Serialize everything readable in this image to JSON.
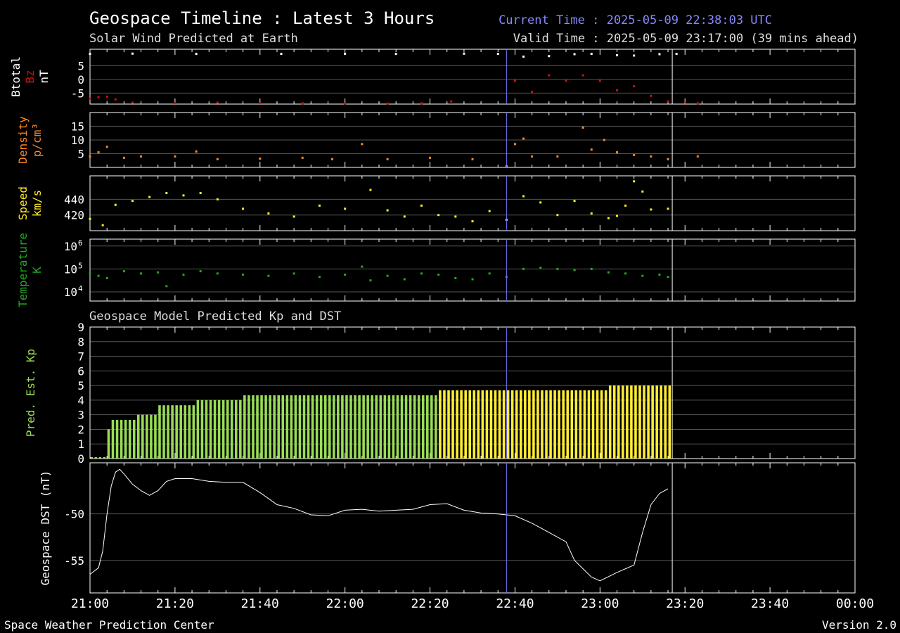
{
  "header": {
    "title": "Geospace Timeline : Latest 3 Hours",
    "subtitle": "Solar Wind Predicted at Earth",
    "current_time": "Current Time : 2025-05-09 22:38:03 UTC",
    "valid_time": "Valid Time : 2025-05-09 23:17:00 (39 mins ahead)"
  },
  "model_title": "Geospace Model Predicted Kp and DST",
  "footer": {
    "left": "Space Weather Prediction Center",
    "right": "Version 2.0"
  },
  "colors": {
    "background": "#000000",
    "btotal": "#ffffff",
    "bz": "#cc1111",
    "density": "#ff8822",
    "speed": "#ffee22",
    "temperature": "#22aa22",
    "kp_green": "#99dd55",
    "kp_yellow": "#ffee33",
    "current_line": "#7777ff",
    "valid_line": "#ffffff",
    "current_time_text": "#8888ff",
    "valid_time_text": "#dddddd",
    "grid": "#555555"
  },
  "chart_data": [
    {
      "panel": "magnetic_field",
      "type": "scatter",
      "ylabels": [
        {
          "text": "Btotal",
          "color": "#ffffff"
        },
        {
          "text": "Bz",
          "color": "#cc1111"
        },
        {
          "text": "nT",
          "color": "#ffffff"
        }
      ],
      "ylim": [
        -9,
        11
      ],
      "yticks": [
        {
          "v": 5,
          "label": "5"
        },
        {
          "v": 0,
          "label": "0"
        },
        {
          "v": -5,
          "label": "-5"
        }
      ],
      "series": [
        {
          "name": "Btotal",
          "color": "#ffffff",
          "points": [
            [
              0,
              9.3
            ],
            [
              10,
              9.4
            ],
            [
              25,
              9.3
            ],
            [
              45,
              9.3
            ],
            [
              60,
              9.3
            ],
            [
              72,
              9.3
            ],
            [
              88,
              9.4
            ],
            [
              96,
              9.3
            ],
            [
              102,
              8.3
            ],
            [
              108,
              8.5
            ],
            [
              114,
              9.2
            ],
            [
              118,
              9.3
            ],
            [
              124,
              8.8
            ],
            [
              128,
              8.7
            ],
            [
              134,
              9.2
            ],
            [
              138,
              9.3
            ]
          ]
        },
        {
          "name": "Bz",
          "color": "#cc1111",
          "points": [
            [
              0,
              -7
            ],
            [
              2,
              -6.5
            ],
            [
              4,
              -6.3
            ],
            [
              6,
              -7.3
            ],
            [
              10,
              -8.5
            ],
            [
              20,
              -8.6
            ],
            [
              30,
              -8.5
            ],
            [
              40,
              -8.6
            ],
            [
              50,
              -8.7
            ],
            [
              60,
              -8.8
            ],
            [
              70,
              -8.8
            ],
            [
              78,
              -8.7
            ],
            [
              85,
              -8
            ],
            [
              100,
              -0.5
            ],
            [
              104,
              -4.5
            ],
            [
              108,
              1.5
            ],
            [
              112,
              -0.5
            ],
            [
              116,
              1.5
            ],
            [
              120,
              -0.5
            ],
            [
              124,
              -4
            ],
            [
              128,
              -2.5
            ],
            [
              132,
              -6
            ],
            [
              136,
              -8
            ],
            [
              140,
              -8.5
            ],
            [
              143,
              -8.7
            ]
          ]
        }
      ]
    },
    {
      "panel": "density",
      "type": "scatter",
      "ylabels": [
        {
          "text": "Density",
          "color": "#ff8822"
        },
        {
          "text": "p/cm³",
          "color": "#ff8822"
        }
      ],
      "ylim": [
        0,
        20
      ],
      "yticks": [
        {
          "v": 15,
          "label": "15"
        },
        {
          "v": 10,
          "label": "10"
        },
        {
          "v": 5,
          "label": "5"
        }
      ],
      "series": [
        {
          "name": "Density",
          "color": "#ff8822",
          "points": [
            [
              0,
              4
            ],
            [
              2,
              5.5
            ],
            [
              4,
              7.5
            ],
            [
              8,
              3.5
            ],
            [
              12,
              4
            ],
            [
              20,
              4
            ],
            [
              25,
              5.8
            ],
            [
              30,
              3
            ],
            [
              40,
              3.2
            ],
            [
              50,
              3.5
            ],
            [
              57,
              3
            ],
            [
              64,
              8.5
            ],
            [
              70,
              3
            ],
            [
              80,
              3.5
            ],
            [
              90,
              3
            ],
            [
              98,
              0.5
            ],
            [
              100,
              8.5
            ],
            [
              102,
              10.5
            ],
            [
              104,
              4
            ],
            [
              110,
              4
            ],
            [
              116,
              14.5
            ],
            [
              118,
              6.5
            ],
            [
              121,
              10
            ],
            [
              124,
              5.5
            ],
            [
              128,
              4.5
            ],
            [
              132,
              4
            ],
            [
              136,
              3
            ],
            [
              143,
              4
            ]
          ]
        }
      ]
    },
    {
      "panel": "speed",
      "type": "scatter",
      "ylabels": [
        {
          "text": "Speed",
          "color": "#ffee22"
        },
        {
          "text": "km/s",
          "color": "#ffee22"
        }
      ],
      "ylim": [
        400,
        470
      ],
      "yticks": [
        {
          "v": 440,
          "label": "440"
        },
        {
          "v": 420,
          "label": "420"
        }
      ],
      "series": [
        {
          "name": "Speed",
          "color": "#ffee22",
          "points": [
            [
              0,
              415
            ],
            [
              3,
              407
            ],
            [
              6,
              433
            ],
            [
              10,
              438
            ],
            [
              14,
              443
            ],
            [
              18,
              448
            ],
            [
              22,
              445
            ],
            [
              26,
              448
            ],
            [
              30,
              440
            ],
            [
              36,
              428
            ],
            [
              42,
              422
            ],
            [
              48,
              418
            ],
            [
              54,
              432
            ],
            [
              60,
              428
            ],
            [
              66,
              452
            ],
            [
              70,
              426
            ],
            [
              74,
              418
            ],
            [
              78,
              432
            ],
            [
              82,
              420
            ],
            [
              86,
              418
            ],
            [
              90,
              412
            ],
            [
              94,
              425
            ],
            [
              98,
              414
            ],
            [
              102,
              444
            ],
            [
              106,
              436
            ],
            [
              110,
              420
            ],
            [
              114,
              438
            ],
            [
              118,
              422
            ],
            [
              122,
              416
            ],
            [
              124,
              419
            ],
            [
              126,
              432
            ],
            [
              128,
              463
            ],
            [
              130,
              450
            ],
            [
              132,
              427
            ],
            [
              136,
              428
            ]
          ]
        }
      ]
    },
    {
      "panel": "temperature",
      "type": "scatter",
      "log": true,
      "ylabels": [
        {
          "text": "Temperature",
          "color": "#22aa22"
        },
        {
          "text": "K",
          "color": "#22aa22"
        }
      ],
      "ylim": [
        3.6,
        6.3
      ],
      "yticks": [
        {
          "v": 6,
          "label": "10",
          "sup": "6"
        },
        {
          "v": 5,
          "label": "10",
          "sup": "5"
        },
        {
          "v": 4,
          "label": "10",
          "sup": "4"
        }
      ],
      "series": [
        {
          "name": "Temperature",
          "color": "#22aa22",
          "points": [
            [
              0,
              4.8
            ],
            [
              2,
              4.7
            ],
            [
              4,
              4.6
            ],
            [
              8,
              4.9
            ],
            [
              12,
              4.8
            ],
            [
              16,
              4.85
            ],
            [
              18,
              4.25
            ],
            [
              22,
              4.75
            ],
            [
              26,
              4.9
            ],
            [
              30,
              4.8
            ],
            [
              36,
              4.75
            ],
            [
              42,
              4.7
            ],
            [
              48,
              4.8
            ],
            [
              54,
              4.65
            ],
            [
              60,
              4.75
            ],
            [
              64,
              5.1
            ],
            [
              66,
              4.5
            ],
            [
              70,
              4.7
            ],
            [
              74,
              4.55
            ],
            [
              78,
              4.8
            ],
            [
              82,
              4.75
            ],
            [
              86,
              4.6
            ],
            [
              90,
              4.55
            ],
            [
              94,
              4.8
            ],
            [
              98,
              4.65
            ],
            [
              102,
              5.0
            ],
            [
              106,
              5.05
            ],
            [
              110,
              5.0
            ],
            [
              114,
              4.95
            ],
            [
              118,
              5.0
            ],
            [
              122,
              4.85
            ],
            [
              126,
              4.8
            ],
            [
              130,
              4.7
            ],
            [
              134,
              4.75
            ],
            [
              136,
              4.65
            ]
          ]
        }
      ]
    },
    {
      "panel": "kp",
      "type": "bar",
      "ylabels": [
        {
          "text": "Pred. Est. Kp",
          "color": "#99dd55"
        }
      ],
      "ylim": [
        0,
        9
      ],
      "yticks": [
        {
          "v": 9,
          "label": "9"
        },
        {
          "v": 8,
          "label": "8"
        },
        {
          "v": 7,
          "label": "7"
        },
        {
          "v": 6,
          "label": "6"
        },
        {
          "v": 5,
          "label": "5"
        },
        {
          "v": 4,
          "label": "4"
        },
        {
          "v": 3,
          "label": "3"
        },
        {
          "v": 2,
          "label": "2"
        },
        {
          "v": 1,
          "label": "1"
        },
        {
          "v": 0,
          "label": "0"
        }
      ],
      "segments": [
        {
          "start": 0,
          "end": 4,
          "value": 0.1,
          "color": "#99dd55"
        },
        {
          "start": 4,
          "end": 5,
          "value": 2.0,
          "color": "#99dd55"
        },
        {
          "start": 5,
          "end": 11,
          "value": 2.65,
          "color": "#99dd55"
        },
        {
          "start": 11,
          "end": 16,
          "value": 3.0,
          "color": "#99dd55"
        },
        {
          "start": 16,
          "end": 25,
          "value": 3.65,
          "color": "#99dd55"
        },
        {
          "start": 25,
          "end": 36,
          "value": 4.0,
          "color": "#99dd55"
        },
        {
          "start": 36,
          "end": 82,
          "value": 4.33,
          "color": "#99dd55"
        },
        {
          "start": 82,
          "end": 122,
          "value": 4.67,
          "color": "#ffee33"
        },
        {
          "start": 122,
          "end": 137,
          "value": 5.0,
          "color": "#ffee33"
        }
      ]
    },
    {
      "panel": "dst",
      "type": "line",
      "ylabels": [
        {
          "text": "Geospace DST (nT)",
          "color": "#ffffff"
        }
      ],
      "ylim": [
        -58.5,
        -44.5
      ],
      "yticks": [
        {
          "v": -50,
          "label": "-50"
        },
        {
          "v": -55,
          "label": "-55"
        }
      ],
      "series": [
        {
          "name": "DST",
          "color": "#ffffff",
          "points": [
            [
              0,
              -56.5
            ],
            [
              2,
              -55.8
            ],
            [
              3,
              -54
            ],
            [
              4,
              -50
            ],
            [
              5,
              -47
            ],
            [
              6,
              -45.5
            ],
            [
              7,
              -45.2
            ],
            [
              8,
              -45.7
            ],
            [
              10,
              -46.8
            ],
            [
              12,
              -47.5
            ],
            [
              14,
              -48
            ],
            [
              16,
              -47.5
            ],
            [
              18,
              -46.5
            ],
            [
              20,
              -46.2
            ],
            [
              24,
              -46.2
            ],
            [
              28,
              -46.5
            ],
            [
              32,
              -46.6
            ],
            [
              36,
              -46.6
            ],
            [
              40,
              -47.7
            ],
            [
              44,
              -49
            ],
            [
              48,
              -49.4
            ],
            [
              52,
              -50.1
            ],
            [
              56,
              -50.2
            ],
            [
              60,
              -49.6
            ],
            [
              64,
              -49.5
            ],
            [
              68,
              -49.7
            ],
            [
              72,
              -49.6
            ],
            [
              76,
              -49.5
            ],
            [
              80,
              -49
            ],
            [
              84,
              -48.9
            ],
            [
              88,
              -49.6
            ],
            [
              92,
              -49.9
            ],
            [
              96,
              -50
            ],
            [
              100,
              -50.2
            ],
            [
              104,
              -51
            ],
            [
              108,
              -52
            ],
            [
              112,
              -53
            ],
            [
              114,
              -55
            ],
            [
              118,
              -56.8
            ],
            [
              120,
              -57.2
            ],
            [
              124,
              -56.3
            ],
            [
              128,
              -55.5
            ],
            [
              130,
              -52
            ],
            [
              132,
              -49
            ],
            [
              134,
              -47.8
            ],
            [
              136,
              -47.3
            ]
          ]
        }
      ]
    }
  ],
  "x_axis": {
    "tick_labels": [
      "21:00",
      "21:20",
      "21:40",
      "22:00",
      "22:20",
      "22:40",
      "23:00",
      "23:20",
      "23:40",
      "00:00"
    ],
    "minutes_per_tick": 20,
    "total_minutes": 180,
    "current_time_minute": 98,
    "valid_time_minute": 137
  }
}
